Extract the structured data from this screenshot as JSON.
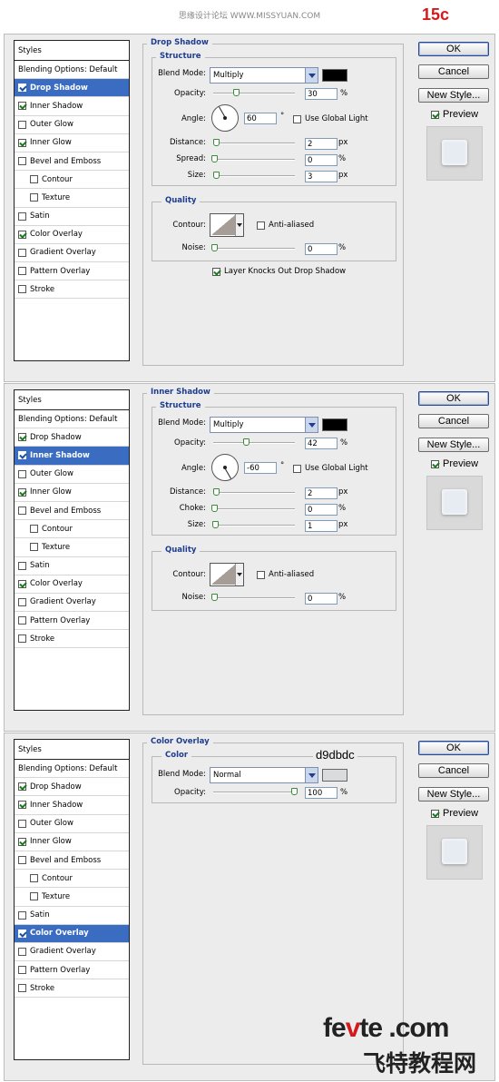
{
  "header": {
    "site": "思缘设计论坛 WWW.MISSYUAN.COM",
    "step": "15c"
  },
  "buttons": {
    "ok": "OK",
    "cancel": "Cancel",
    "new_style": "New Style...",
    "preview": "Preview"
  },
  "list_items": [
    "Styles",
    "Blending Options: Default",
    "Drop Shadow",
    "Inner Shadow",
    "Outer Glow",
    "Inner Glow",
    "Bevel and Emboss",
    "Contour",
    "Texture",
    "Satin",
    "Color Overlay",
    "Gradient Overlay",
    "Pattern Overlay",
    "Stroke"
  ],
  "labels": {
    "structure": "Structure",
    "quality": "Quality",
    "color": "Color",
    "blend_mode": "Blend Mode:",
    "opacity": "Opacity:",
    "angle": "Angle:",
    "use_global_light": "Use Global Light",
    "distance": "Distance:",
    "spread": "Spread:",
    "choke": "Choke:",
    "size": "Size:",
    "contour": "Contour:",
    "anti_aliased": "Anti-aliased",
    "noise": "Noise:",
    "layer_knocks_out": "Layer Knocks Out Drop Shadow",
    "px": "px",
    "pct": "%",
    "deg": "°"
  },
  "drop_shadow": {
    "title": "Drop Shadow",
    "blend_mode": "Multiply",
    "color": "#000000",
    "opacity": "30",
    "angle": "60",
    "distance": "2",
    "spread": "0",
    "size": "3",
    "noise": "0"
  },
  "inner_shadow": {
    "title": "Inner Shadow",
    "blend_mode": "Multiply",
    "color": "#000000",
    "opacity": "42",
    "angle": "-60",
    "distance": "2",
    "choke": "0",
    "size": "1",
    "noise": "0"
  },
  "color_overlay": {
    "title": "Color Overlay",
    "blend_mode": "Normal",
    "color": "#d9dbdc",
    "hex_label": "d9dbdc",
    "opacity": "100"
  },
  "brand": {
    "fevte_pre": "fe",
    "fevte_v": "v",
    "fevte_post": "te .com",
    "cn": "飞特教程网"
  }
}
